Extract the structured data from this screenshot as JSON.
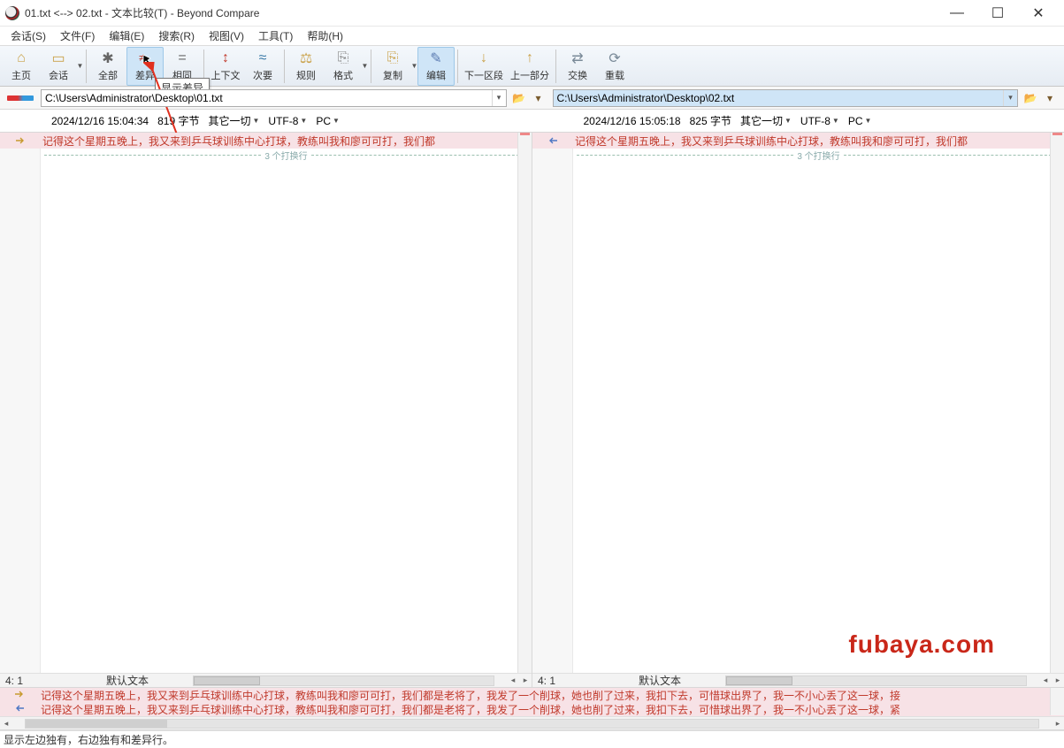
{
  "title": "01.txt <--> 02.txt - 文本比较(T) - Beyond Compare",
  "window_controls": {
    "min": "—",
    "max": "☐",
    "close": "✕"
  },
  "menu": [
    "会话(S)",
    "文件(F)",
    "编辑(E)",
    "搜索(R)",
    "视图(V)",
    "工具(T)",
    "帮助(H)"
  ],
  "toolbar": [
    {
      "label": "主页",
      "glyph": "⌂",
      "color": "#caa24a"
    },
    {
      "label": "会话",
      "glyph": "▭",
      "color": "#caa24a",
      "dd": true
    },
    {
      "sep": true
    },
    {
      "label": "全部",
      "glyph": "✱",
      "color": "#666"
    },
    {
      "label": "差异",
      "glyph": "≠",
      "color": "#c0392b",
      "active": true,
      "cursor": true
    },
    {
      "label": "相同",
      "glyph": "=",
      "color": "#666"
    },
    {
      "sep": true
    },
    {
      "label": "上下文",
      "glyph": "↕",
      "color": "#c0392b"
    },
    {
      "label": "次要",
      "glyph": "≈",
      "color": "#3a7aa8"
    },
    {
      "sep": true
    },
    {
      "label": "规则",
      "glyph": "⚖",
      "color": "#caa24a"
    },
    {
      "label": "格式",
      "glyph": "⎘",
      "color": "#888",
      "dd": true
    },
    {
      "sep": true
    },
    {
      "label": "复制",
      "glyph": "⎘",
      "color": "#caa24a",
      "dd": true
    },
    {
      "label": "编辑",
      "glyph": "✎",
      "color": "#5a7ab0",
      "active": true
    },
    {
      "sep": true
    },
    {
      "label": "下一区段",
      "glyph": "↓",
      "color": "#caa24a"
    },
    {
      "label": "上一部分",
      "glyph": "↑",
      "color": "#caa24a"
    },
    {
      "sep": true
    },
    {
      "label": "交换",
      "glyph": "⇄",
      "color": "#7a8a98"
    },
    {
      "label": "重载",
      "glyph": "⟳",
      "color": "#7a8a98"
    }
  ],
  "tooltip": "显示差异",
  "left": {
    "path": "C:\\Users\\Administrator\\Desktop\\01.txt",
    "date": "2024/12/16 15:04:34",
    "size": "819 字节",
    "filter": "其它一切",
    "encoding": "UTF-8",
    "platform": "PC",
    "line_text": "记得这个星期五晚上，我又来到乒乓球训练中心打球，教练叫我和廖可可打，我们都",
    "trailing_hint": "3 个打换行",
    "caret": "4: 1",
    "mode": "默认文本"
  },
  "right": {
    "path": "C:\\Users\\Administrator\\Desktop\\02.txt",
    "date": "2024/12/16 15:05:18",
    "size": "825 字节",
    "filter": "其它一切",
    "encoding": "UTF-8",
    "platform": "PC",
    "line_text": "记得这个星期五晚上，我又来到乒乓球训练中心打球，教练叫我和廖可可打，我们都",
    "trailing_hint": "3 个打换行",
    "caret": "4: 1",
    "mode": "默认文本"
  },
  "preview": {
    "row1": "记得这个星期五晚上，我又来到乒乓球训练中心打球，教练叫我和廖可可打，我们都是老将了，我发了一个削球，她也削了过来，我扣下去，可惜球出界了，我一不小心丢了这一球，接",
    "row2": "记得这个星期五晚上，我又来到乒乓球训练中心打球，教练叫我和廖可可打，我们都是老将了，我发了一个削球，她也削了过来，我扣下去，可惜球出界了，我一不小心丢了这一球，紧"
  },
  "status": "显示左边独有，右边独有和差异行。",
  "watermark": "fubaya.com"
}
